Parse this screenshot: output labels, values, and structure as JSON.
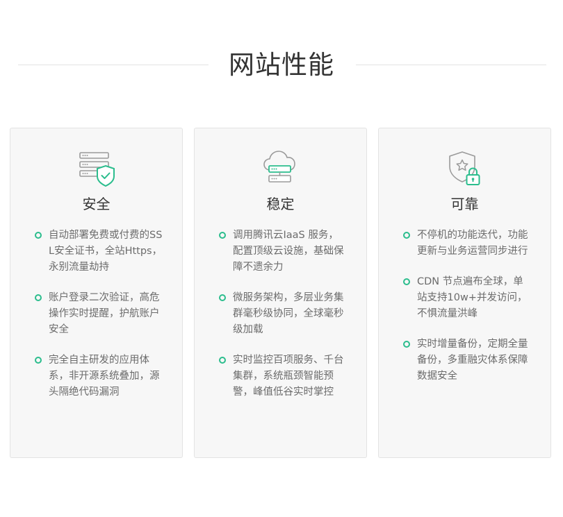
{
  "section": {
    "title": "网站性能"
  },
  "cards": [
    {
      "icon": "server-shield-icon",
      "title": "安全",
      "items": [
        "自动部署免费或付费的SSL安全证书，全站Https，永别流量劫持",
        "账户登录二次验证，高危操作实时提醒，护航账户安全",
        "完全自主研发的应用体系，非开源系统叠加，源头隔绝代码漏洞"
      ]
    },
    {
      "icon": "cloud-server-icon",
      "title": "稳定",
      "items": [
        "调用腾讯云IaaS 服务，配置顶级云设施，基础保障不遗余力",
        "微服务架构，多层业务集群毫秒级协同，全球毫秒级加载",
        "实时监控百项服务、千台集群，系统瓶颈智能预警，峰值低谷实时掌控"
      ]
    },
    {
      "icon": "shield-lock-icon",
      "title": "可靠",
      "items": [
        "不停机的功能迭代，功能更新与业务运营同步进行",
        "CDN 节点遍布全球，单站支持10w+并发访问，不惧流量洪峰",
        "实时增量备份，定期全量备份，多重融灾体系保障数据安全"
      ]
    }
  ],
  "colors": {
    "accent": "#2bbd8d",
    "icon_gray": "#9a9a9a",
    "card_bg": "#f7f7f7",
    "text_muted": "#6b6b6b"
  }
}
